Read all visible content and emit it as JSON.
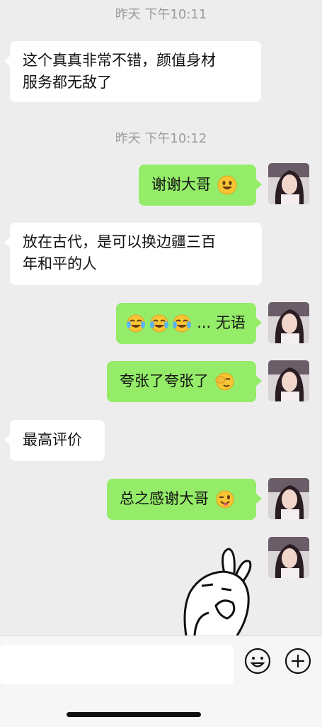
{
  "timestamps": [
    "昨天 下午10:11",
    "昨天 下午10:12"
  ],
  "messages": [
    {
      "side": "left",
      "line1": "这个真真非常不错，颜值身材",
      "line2": "服务都无敌了"
    },
    {
      "side": "right",
      "text": "谢谢大哥",
      "emoji": "grinning-face-emoji"
    },
    {
      "side": "left",
      "line1": "放在古代，是可以换边疆三百",
      "line2": "年和平的人"
    },
    {
      "side": "right",
      "text": "... 无语",
      "emoji": "three-crying-laughing-emojis"
    },
    {
      "side": "right",
      "text": "夸张了夸张了",
      "emoji": "facepalm-smile-emoji"
    },
    {
      "side": "left",
      "text": "最高评价"
    },
    {
      "side": "right",
      "text": "总之感谢大哥",
      "emoji": "winking-face-emoji"
    },
    {
      "side": "right",
      "sticker": "rabbit-sticker"
    }
  ],
  "input": {
    "placeholder": ""
  },
  "buttons": {
    "emoji": "emoji-face-icon",
    "more": "plus-icon"
  },
  "colors": {
    "background": "#ededed",
    "right_bubble": "#95ec69",
    "left_bubble": "#ffffff",
    "timestamp": "#9b9b9b"
  }
}
